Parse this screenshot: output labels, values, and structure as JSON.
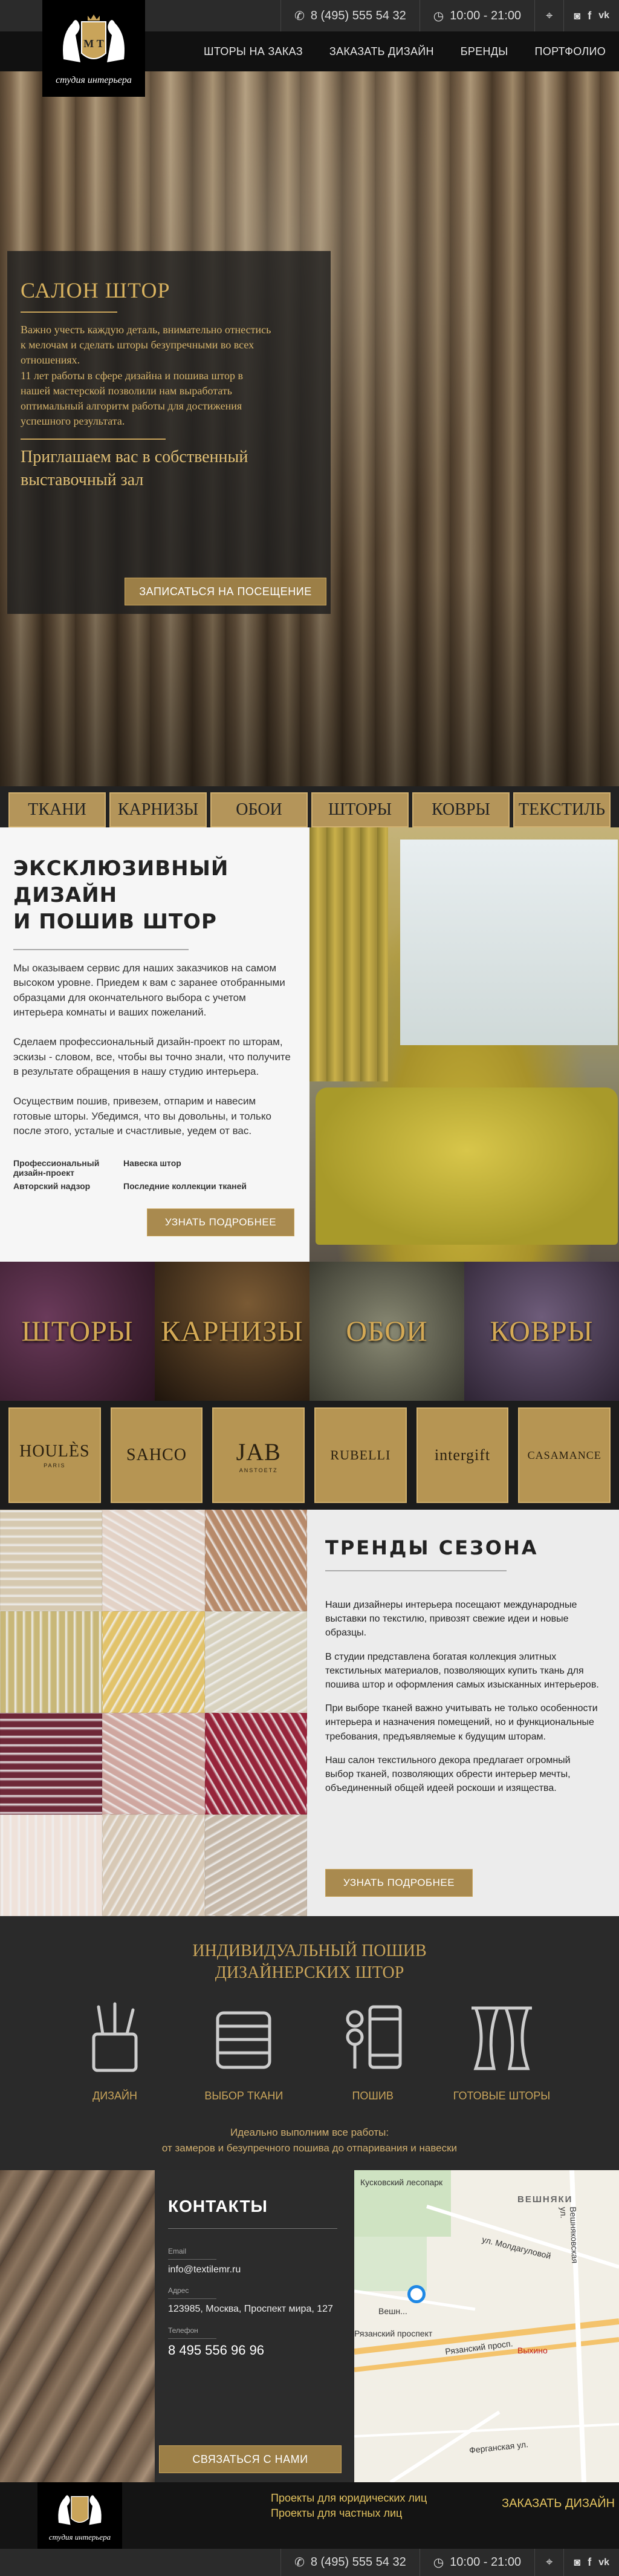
{
  "header": {
    "phone": "8 (495) 555 54 32",
    "hours": "10:00 - 21:00",
    "logo_monogram": "М Т",
    "logo_text": "студия интерьера",
    "nav": [
      "ШТОРЫ НА ЗАКАЗ",
      "ЗАКАЗАТЬ ДИЗАЙН",
      "БРЕНДЫ",
      "ПОРТФОЛИО"
    ],
    "icons": [
      "phone-icon",
      "clock-icon",
      "location-icon",
      "instagram-icon",
      "facebook-icon",
      "vk-icon"
    ]
  },
  "hero": {
    "title": "САЛОН ШТОР",
    "text": "Важно учесть каждую деталь, внимательно отнестись\nк мелочам и сделать шторы безупречными во всех\nотношениях.\n11 лет работы в сфере дизайна и пошива штор в\nнашей мастерской позволили нам выработать\nоптимальный алгоритм работы для достижения\nуспешного результата.",
    "invite": "Приглашаем вас в собственный выставочный зал",
    "button": "ЗАПИСАТЬСЯ НА ПОСЕЩЕНИЕ"
  },
  "categories": [
    "ТКАНИ",
    "КАРНИЗЫ",
    "ОБОИ",
    "ШТОРЫ",
    "КОВРЫ",
    "ТЕКСТИЛЬ"
  ],
  "exclusive": {
    "title": "ЭКСКЛЮЗИВНЫЙ  ДИЗАЙН\nИ ПОШИВ ШТОР",
    "p1": "Мы оказываем сервис для наших заказчиков на самом высоком уровне. Приедем к вам с заранее отобранными образцами для окончательного выбора с учетом интерьера комнаты и ваших пожеланий.",
    "p2": "Сделаем профессиональный дизайн-проект по шторам, эскизы - словом, все, чтобы вы точно знали, что получите в результате обращения в нашу студию интерьера.",
    "p3": "Осуществим пошив, привезем, отпарим и навесим готовые шторы. Убедимся, что вы довольны, и только после этого, усталые и счастливые, уедем от вас.",
    "features": [
      "Профессиональный дизайн-проект",
      "Навеска штор",
      "Авторский надзор",
      "Последние коллекции тканей"
    ],
    "button": "УЗНАТЬ ПОДРОБНЕЕ"
  },
  "banners": [
    {
      "label": "ШТОРЫ",
      "color": "#3a1f3a"
    },
    {
      "label": "КАРНИЗЫ",
      "color": "#3b2a1c"
    },
    {
      "label": "ОБОИ",
      "color": "#5a5a4a"
    },
    {
      "label": "КОВРЫ",
      "color": "#4a3a54"
    }
  ],
  "brands": [
    {
      "name": "HOULÈS",
      "sub": "PARIS"
    },
    {
      "name": "SAHCO",
      "sub": ""
    },
    {
      "name": "JAB",
      "sub": "ANSTOETZ"
    },
    {
      "name": "RUBELLI",
      "sub": ""
    },
    {
      "name": "intergift",
      "sub": ""
    },
    {
      "name": "CASAMANCE",
      "sub": ""
    }
  ],
  "trends": {
    "title": "ТРЕНДЫ СЕЗОНА",
    "p1": "Наши дизайнеры интерьера посещают международные выставки по текстилю, привозят свежие идеи и новые образцы.",
    "p2": "В студии представлена  богатая коллекция элитных текстильных материалов, позволяющих купить ткань для пошива штор и оформления самых изысканных интерьеров.",
    "p3": "При выборе тканей важно учитывать не только особенности интерьера и назначения помещений, но и функциональные требования, предъявляемые к будущим шторам.",
    "p4": "Наш салон текстильного декора предлагает огромный выбор тканей, позволяющих обрести интерьер мечты, объединенный общей идеей роскоши и изящества.",
    "button": "УЗНАТЬ ПОДРОБНЕЕ",
    "swatches": [
      "#d6c9b0",
      "#e3d2c6",
      "#b78a6a",
      "#c8b778",
      "#e2c36a",
      "#d8d2be",
      "#6e2838",
      "#cfa7a0",
      "#96243a",
      "#efe2da",
      "#d8c9b6",
      "#c6b8a8"
    ]
  },
  "services": {
    "title": "ИНДИВИДУАЛЬНЫЙ ПОШИВ\nДИЗАЙНЕРСКИХ ШТОР",
    "items": [
      "ДИЗАЙН",
      "ВЫБОР ТКАНИ",
      "ПОШИВ",
      "ГОТОВЫЕ ШТОРЫ"
    ],
    "note": "Идеально выполним все работы:\nот замеров и безупречного пошива до отпаривания и навески"
  },
  "contacts": {
    "title": "КОНТАКТЫ",
    "email_label": "Email",
    "email": "info@textilemr.ru",
    "address_label": "Адрес",
    "address": "123985, Москва, Проспект мира, 127",
    "phone_label": "Телефон",
    "phone": "8 495 556 96 96",
    "button": "СВЯЗАТЬСЯ С НАМИ"
  },
  "map": {
    "labels": [
      "Кусковский лесопарк",
      "ВЕШНЯКИ",
      "ул. Молдагуловой",
      "Вешняковская ул.",
      "Вешн...",
      "Рязанский проспект",
      "Рязанский просп.",
      "Выхино",
      "Ферганская ул."
    ]
  },
  "footer": {
    "link1": "Проекты для юридических лиц",
    "link2": "Проекты для частных лиц",
    "cta": "ЗАКАЗАТЬ ДИЗАЙН",
    "phone": "8 (495) 555 54 32",
    "hours": "10:00 - 21:00"
  }
}
